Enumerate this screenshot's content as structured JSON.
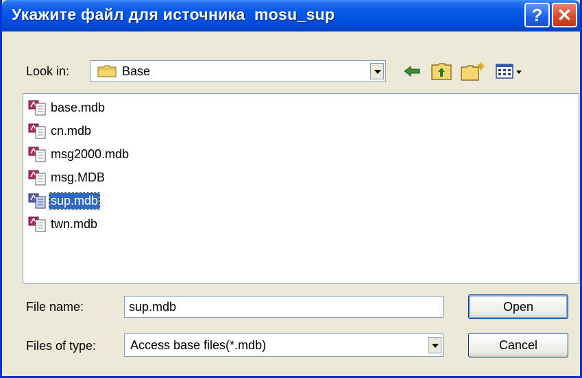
{
  "title": "Укажите файл для источника  mosu_sup",
  "title_buttons": {
    "help": "?",
    "close": "✕"
  },
  "look_in": {
    "label": "Look in:",
    "value": "Base",
    "icon": "folder-icon"
  },
  "toolbar": [
    "back-arrow-icon",
    "up-folder-icon",
    "new-folder-icon",
    "view-menu-icon"
  ],
  "files": [
    {
      "name": "base.mdb",
      "selected": false
    },
    {
      "name": "cn.mdb",
      "selected": false
    },
    {
      "name": "msg2000.mdb",
      "selected": false
    },
    {
      "name": "msg.MDB",
      "selected": false
    },
    {
      "name": "sup.mdb",
      "selected": true
    },
    {
      "name": "twn.mdb",
      "selected": false
    }
  ],
  "file_name": {
    "label": "File name:",
    "value": "sup.mdb"
  },
  "file_type": {
    "label": "Files of type:",
    "value": "Access base files(*.mdb)"
  },
  "buttons": {
    "open": "Open",
    "cancel": "Cancel"
  },
  "colors": {
    "title_bar": "#0053E1",
    "selection": "#316AC5",
    "dialog_bg": "#ECE9D8",
    "close_button": "#D64A25"
  }
}
